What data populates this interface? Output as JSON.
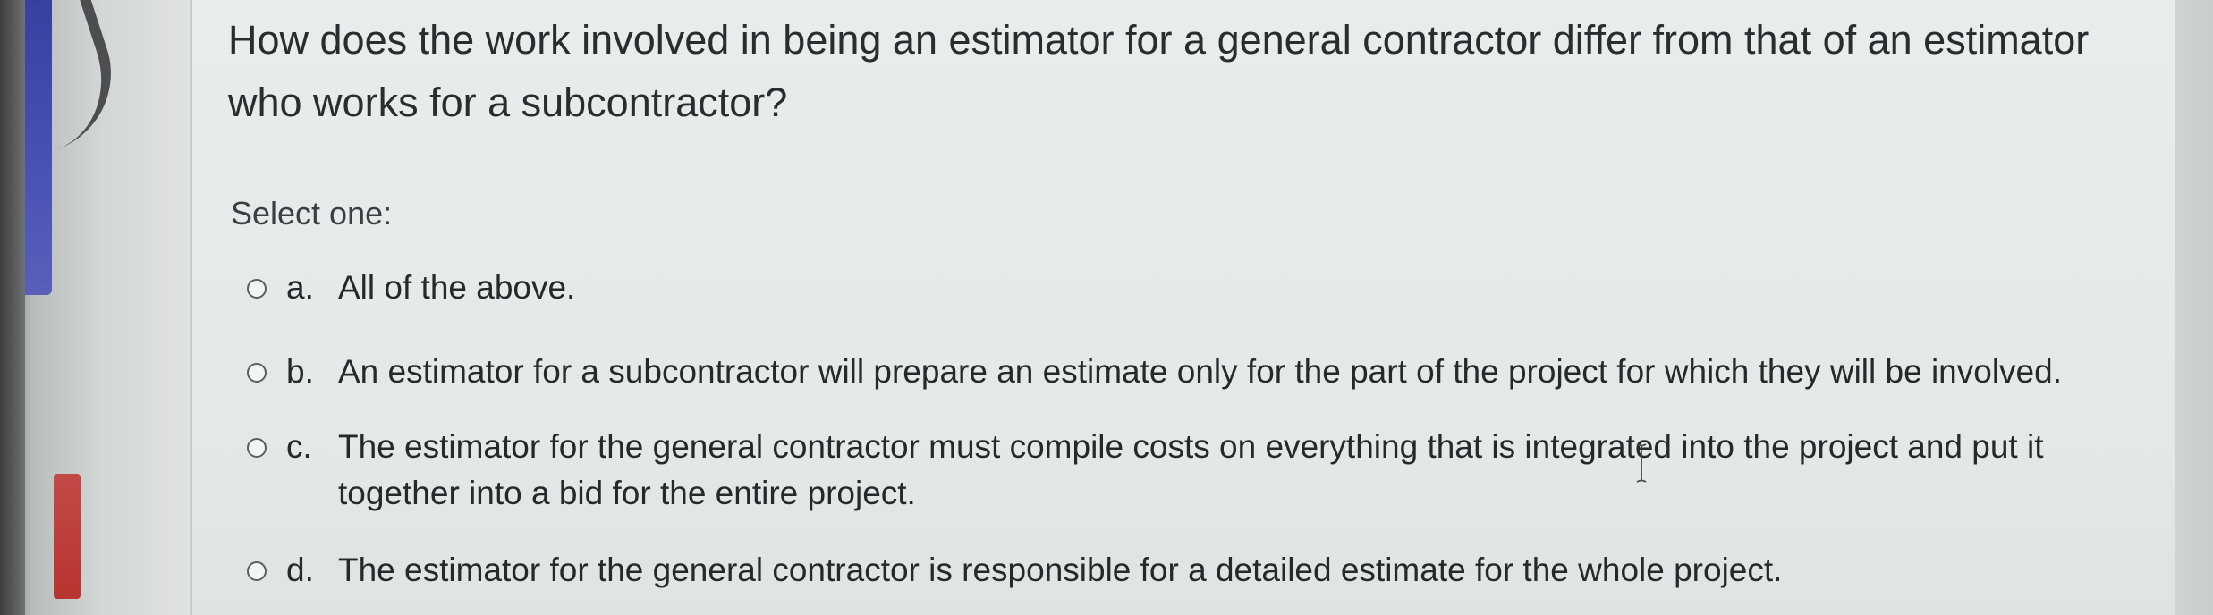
{
  "question": {
    "text": "How does the work involved in being an estimator for a general contractor differ from that of an estimator who works for a subcontractor?"
  },
  "prompt": {
    "select_label": "Select one:"
  },
  "options": [
    {
      "letter": "a.",
      "text": "All of the above."
    },
    {
      "letter": "b.",
      "text": "An estimator for a subcontractor will prepare an estimate only for the part of the project for which they will be involved."
    },
    {
      "letter": "c.",
      "text": "The estimator for the general contractor must compile costs on everything that is integrated into the project and put it together into a bid for the entire project."
    },
    {
      "letter": "d.",
      "text": "The estimator for the general contractor is responsible for a detailed estimate for the whole project."
    }
  ],
  "icons": {
    "radio": "radio-unchecked-icon",
    "cursor": "text-cursor-icon"
  },
  "colors": {
    "panel_background": "#e6eaea",
    "text": "#26292c",
    "sidebar_blue": "#4a52b6",
    "sidebar_red": "#b8342f"
  }
}
